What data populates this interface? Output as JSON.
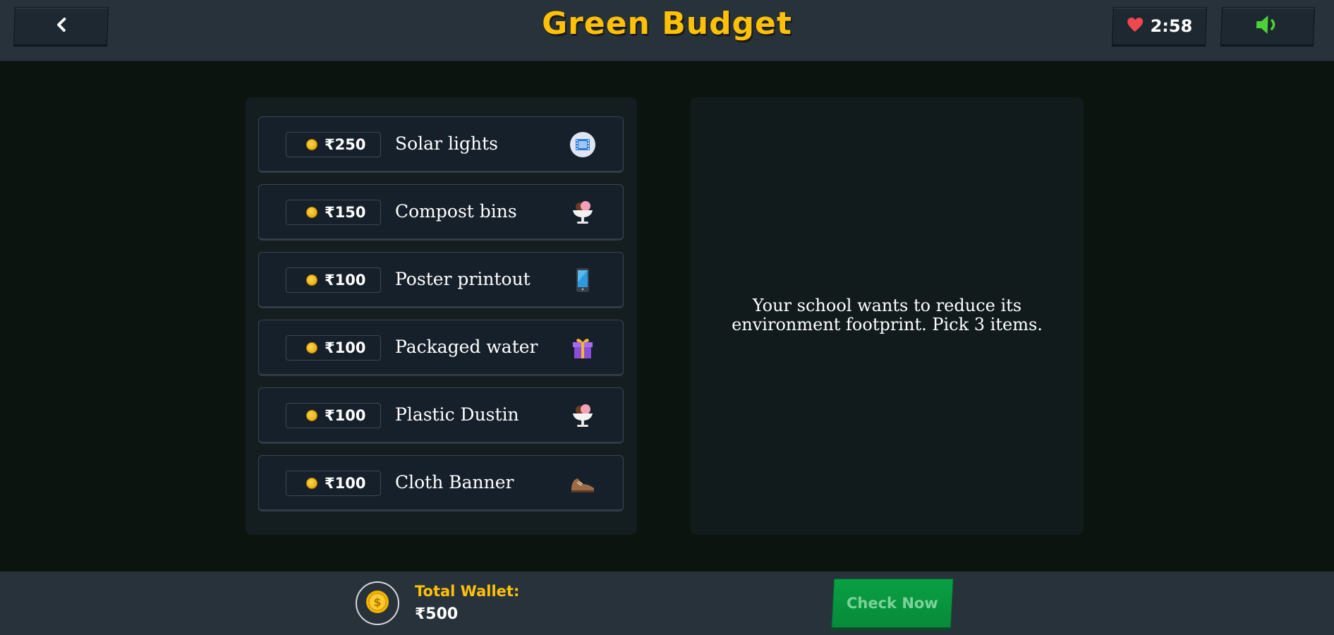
{
  "header": {
    "title": "Green Budget",
    "timer": "2:58",
    "title_color": "#ffc107"
  },
  "items": [
    {
      "price": "₹250",
      "label": "Solar lights",
      "icon": "film-frames-icon"
    },
    {
      "price": "₹150",
      "label": "Compost bins",
      "icon": "ice-cream-icon"
    },
    {
      "price": "₹100",
      "label": "Poster printout",
      "icon": "mobile-phone-icon"
    },
    {
      "price": "₹100",
      "label": "Packaged water",
      "icon": "gift-icon"
    },
    {
      "price": "₹100",
      "label": "Plastic Dustin",
      "icon": "ice-cream-icon"
    },
    {
      "price": "₹100",
      "label": "Cloth Banner",
      "icon": "shoe-icon"
    }
  ],
  "info": {
    "text": "Your school wants to reduce its environment footprint. Pick 3 items."
  },
  "footer": {
    "wallet_label": "Total Wallet:",
    "wallet_value": "₹500",
    "check_label": "Check Now",
    "check_color": "#0a9a40"
  }
}
